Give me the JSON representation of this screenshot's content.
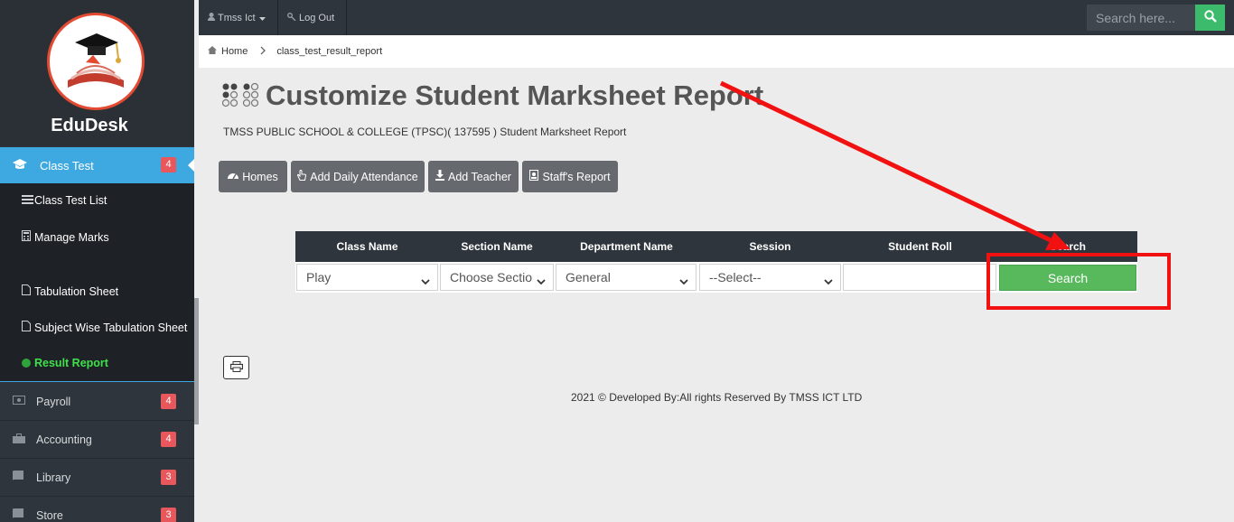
{
  "sidebar": {
    "brand": "EduDesk",
    "active_item": {
      "label": "Class Test",
      "badge": "4"
    },
    "sub_items": [
      {
        "label": "Class Test List"
      },
      {
        "label": "Manage Marks"
      },
      {
        "label": "Tabulation Sheet"
      },
      {
        "label": "Subject Wise Tabulation Sheet"
      },
      {
        "label": "Result Report"
      }
    ],
    "items": [
      {
        "label": "Payroll",
        "badge": "4"
      },
      {
        "label": "Accounting",
        "badge": "4"
      },
      {
        "label": "Library",
        "badge": "3"
      },
      {
        "label": "Store",
        "badge": "3"
      }
    ]
  },
  "topbar": {
    "user_label": "Tmss Ict",
    "logout_label": "Log Out",
    "search_placeholder": "Search here..."
  },
  "breadcrumb": {
    "home": "Home",
    "current": "class_test_result_report"
  },
  "main": {
    "title": "Customize Student Marksheet Report",
    "subtitle": "TMSS PUBLIC SCHOOL & COLLEGE (TPSC)( 137595 ) Student Marksheet Report",
    "actions": [
      "Homes",
      "Add Daily Attendance",
      "Add Teacher",
      "Staff's Report"
    ],
    "form": {
      "headers": [
        "Class Name",
        "Section Name",
        "Department Name",
        "Session",
        "Student Roll",
        "Search"
      ],
      "class_value": "Play",
      "section_value": "Choose Section",
      "department_value": "General",
      "session_value": "--Select--",
      "roll_value": "",
      "search_button": "Search"
    },
    "footer": "2021 © Developed By:All rights Reserved By TMSS ICT LTD"
  },
  "colors": {
    "sidebar_bg": "#2f353c",
    "active_blue": "#3ea8e0",
    "badge_red": "#e8575b",
    "search_green": "#58b85c",
    "annotation_red": "#f21111"
  }
}
